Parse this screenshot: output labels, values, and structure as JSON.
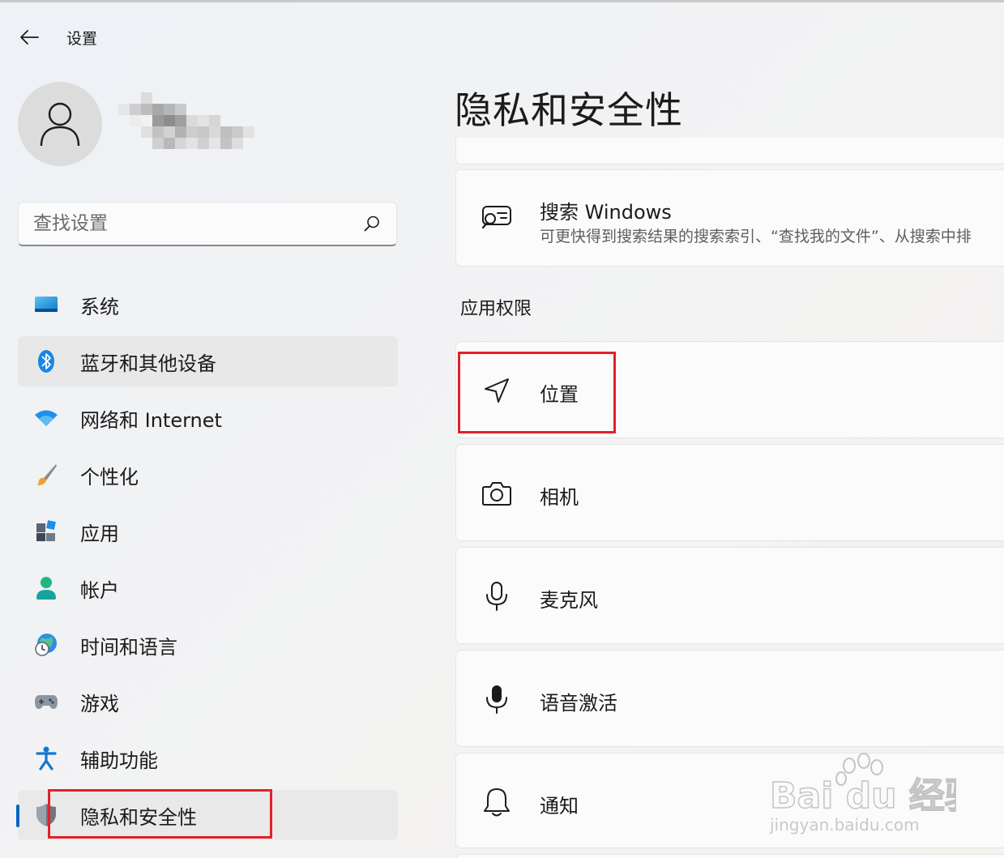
{
  "window": {
    "title": "设置"
  },
  "profile": {
    "name_blurred": true
  },
  "search": {
    "placeholder": "查找设置"
  },
  "sidebar": {
    "items": [
      {
        "label": "系统",
        "icon": "display-icon"
      },
      {
        "label": "蓝牙和其他设备",
        "icon": "bluetooth-icon"
      },
      {
        "label": "网络和 Internet",
        "icon": "wifi-icon"
      },
      {
        "label": "个性化",
        "icon": "brush-icon"
      },
      {
        "label": "应用",
        "icon": "apps-icon"
      },
      {
        "label": "帐户",
        "icon": "account-icon"
      },
      {
        "label": "时间和语言",
        "icon": "globe-clock-icon"
      },
      {
        "label": "游戏",
        "icon": "gamepad-icon"
      },
      {
        "label": "辅助功能",
        "icon": "accessibility-icon"
      },
      {
        "label": "隐私和安全性",
        "icon": "shield-icon"
      }
    ],
    "selected_index": 9,
    "hover_index": 1
  },
  "main": {
    "title": "隐私和安全性",
    "search_windows": {
      "title": "搜索 Windows",
      "subtitle": "可更快得到搜索结果的搜索索引、“查找我的文件”、从搜索中排"
    },
    "section_label": "应用权限",
    "permissions": [
      {
        "label": "位置",
        "icon": "location-icon"
      },
      {
        "label": "相机",
        "icon": "camera-icon"
      },
      {
        "label": "麦克风",
        "icon": "microphone-icon"
      },
      {
        "label": "语音激活",
        "icon": "voice-activation-icon"
      },
      {
        "label": "通知",
        "icon": "bell-icon"
      }
    ]
  },
  "watermark": {
    "brand": "Bai du 经验",
    "url": "jingyan.baidu.com"
  },
  "colors": {
    "accent": "#0067c0",
    "highlight": "#e2202a"
  }
}
